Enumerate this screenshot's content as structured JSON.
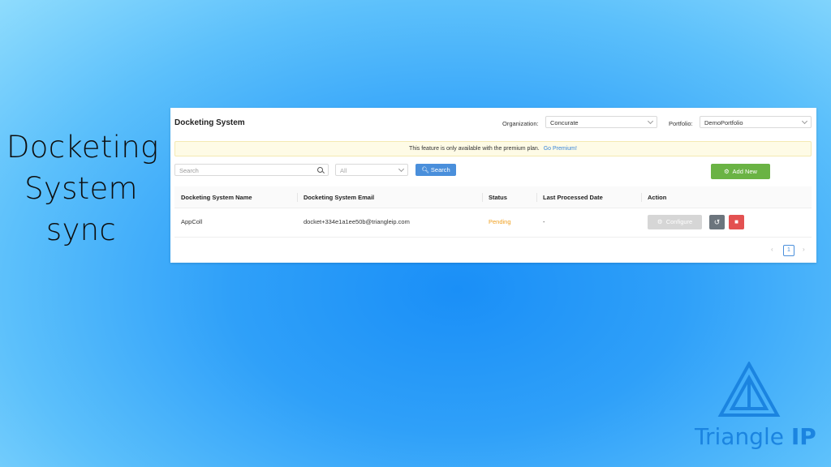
{
  "slide": {
    "title_lines": [
      "Docketing",
      "System",
      "sync"
    ]
  },
  "app": {
    "title": "Docketing System",
    "filters": {
      "organization_label": "Organization:",
      "organization_value": "Concurate",
      "portfolio_label": "Portfolio:",
      "portfolio_value": "DemoPortfolio"
    },
    "banner": {
      "text": "This feature is only available with the premium plan.",
      "link": "Go Premium!"
    },
    "search": {
      "placeholder": "Search",
      "status_select": "All",
      "search_button": "Search",
      "add_button": "Add New"
    },
    "table": {
      "columns": [
        "Docketing System Name",
        "Docketing System Email",
        "Status",
        "Last Processed Date",
        "Action"
      ],
      "rows": [
        {
          "name": "AppColl",
          "email": "docket+334e1a1ee50b@triangleip.com",
          "status": "Pending",
          "last_processed": "-",
          "configure_label": "Configure"
        }
      ]
    },
    "pagination": {
      "current_page": "1",
      "prev": "‹",
      "next": "›"
    }
  },
  "logo": {
    "brand_light": "Triangle ",
    "brand_bold": "IP"
  },
  "colors": {
    "primary": "#4a8fdb",
    "success": "#6ab344",
    "danger": "#e35151",
    "pending": "#f0a020",
    "logo": "#1b84e0"
  }
}
